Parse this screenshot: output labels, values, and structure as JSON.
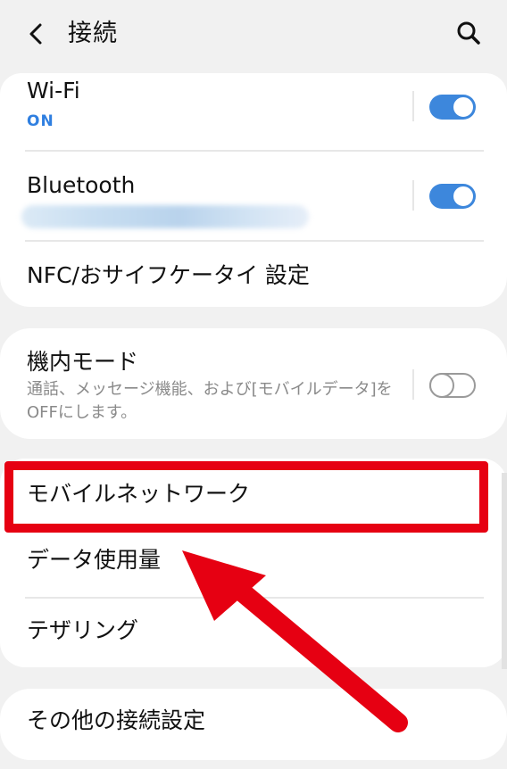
{
  "header": {
    "title": "接続"
  },
  "card1": {
    "wifi": {
      "title": "Wi-Fi",
      "status": "ON",
      "enabled": true
    },
    "bluetooth": {
      "title": "Bluetooth",
      "enabled": true
    },
    "nfc": {
      "title": "NFC/おサイフケータイ 設定"
    }
  },
  "card2": {
    "airplane": {
      "title": "機内モード",
      "desc": "通話、メッセージ機能、および[モバイルデータ]をOFFにします。",
      "enabled": false
    }
  },
  "card3": {
    "mobile_network": {
      "title": "モバイルネットワーク"
    },
    "data_usage": {
      "title": "データ使用量"
    },
    "tethering": {
      "title": "テザリング"
    }
  },
  "card4": {
    "other": {
      "title": "その他の接続設定"
    }
  },
  "colors": {
    "accent": "#3d87dc",
    "highlight": "#e60012"
  },
  "icons": [
    "back-arrow-icon",
    "search-icon",
    "arrow-pointer-icon"
  ]
}
